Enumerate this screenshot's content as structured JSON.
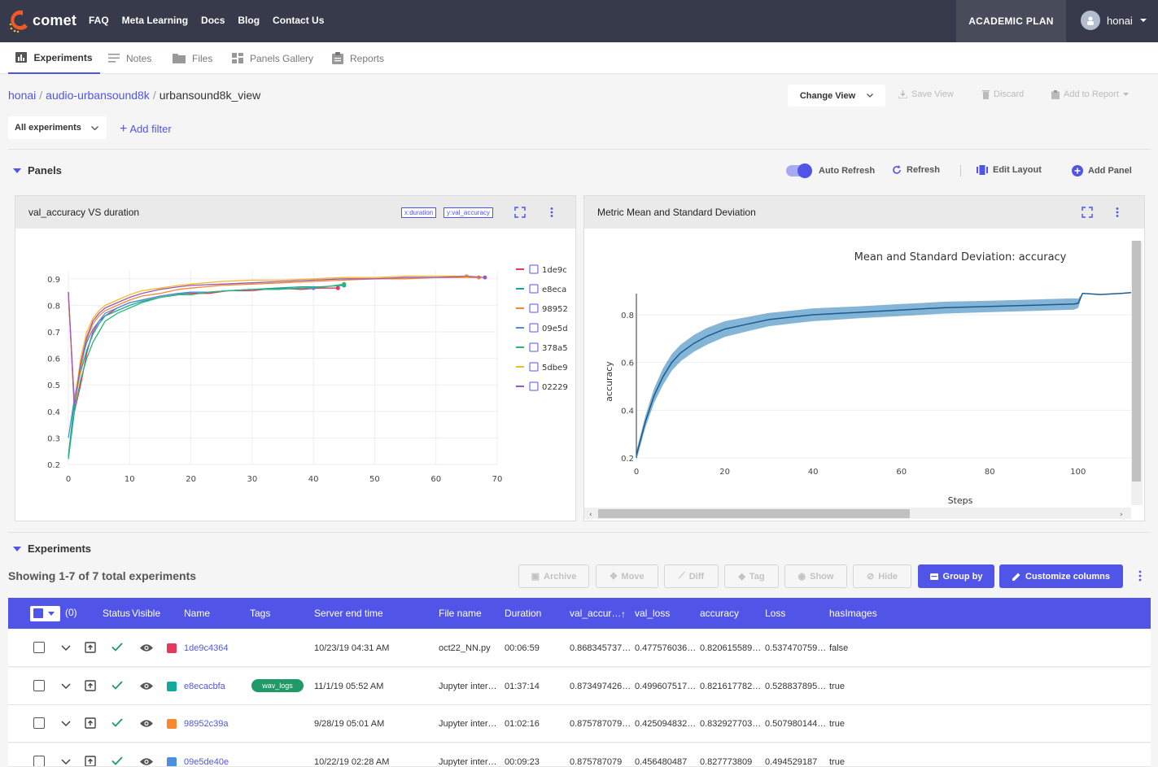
{
  "topbar": {
    "logo": "comet",
    "nav": [
      "FAQ",
      "Meta Learning",
      "Docs",
      "Blog",
      "Contact Us"
    ],
    "plan": "ACADEMIC PLAN",
    "user": "honai"
  },
  "tabs": [
    {
      "label": "Experiments",
      "icon": "bar-chart-icon"
    },
    {
      "label": "Notes",
      "icon": "notes-icon"
    },
    {
      "label": "Files",
      "icon": "folder-icon"
    },
    {
      "label": "Panels Gallery",
      "icon": "gallery-icon"
    },
    {
      "label": "Reports",
      "icon": "clipboard-icon"
    }
  ],
  "breadcrumb": {
    "workspace": "honai",
    "project": "audio-urbansound8k",
    "view": "urbansound8k_view"
  },
  "view_actions": {
    "change_view": "Change View",
    "save_view": "Save View",
    "discard": "Discard",
    "add_to_report": "Add to Report"
  },
  "filters": {
    "selector": "All experiments",
    "add_filter": "Add filter"
  },
  "panels_section": {
    "title": "Panels",
    "auto_refresh": "Auto Refresh",
    "auto_refresh_on": true,
    "refresh": "Refresh",
    "edit_layout": "Edit Layout",
    "add_panel": "Add Panel"
  },
  "panel1": {
    "title": "val_accuracy VS duration",
    "x_tag": "x:duration",
    "y_tag": "y:val_accuracy"
  },
  "panel2": {
    "title": "Metric Mean and Standard Deviation"
  },
  "chart_data": [
    {
      "type": "line",
      "title": "",
      "xlabel": "",
      "ylabel": "",
      "xlim": [
        0,
        70
      ],
      "ylim": [
        0.2,
        0.93
      ],
      "xticks": [
        "0",
        "10",
        "20",
        "30",
        "40",
        "50",
        "60",
        "70"
      ],
      "yticks": [
        "0.2",
        "0.3",
        "0.4",
        "0.5",
        "0.6",
        "0.7",
        "0.8",
        "0.9"
      ],
      "legend": "right",
      "series": [
        {
          "name": "1de9c",
          "color": "#e6375c",
          "x": [
            0,
            1,
            2,
            3,
            4,
            5,
            6,
            8,
            10,
            12,
            15,
            18,
            20,
            23,
            26,
            30,
            34,
            38,
            41,
            44
          ],
          "y": [
            0.85,
            0.4,
            0.5,
            0.62,
            0.7,
            0.74,
            0.76,
            0.79,
            0.81,
            0.82,
            0.835,
            0.845,
            0.845,
            0.845,
            0.855,
            0.855,
            0.865,
            0.86,
            0.865,
            0.865
          ]
        },
        {
          "name": "e8eca",
          "color": "#13a89e",
          "x": [
            0,
            1,
            2,
            3,
            4,
            5,
            6,
            8,
            10,
            12,
            15,
            18,
            20,
            23,
            26,
            30,
            34,
            38,
            41,
            45
          ],
          "y": [
            0.23,
            0.44,
            0.55,
            0.63,
            0.69,
            0.73,
            0.76,
            0.78,
            0.8,
            0.815,
            0.83,
            0.84,
            0.85,
            0.85,
            0.855,
            0.86,
            0.865,
            0.87,
            0.87,
            0.875
          ]
        },
        {
          "name": "98952",
          "color": "#f7882f",
          "x": [
            0,
            1,
            2,
            3,
            4,
            5,
            6,
            8,
            10,
            12,
            15,
            18,
            20,
            25,
            30,
            35,
            40,
            45,
            50,
            55,
            60,
            64,
            67
          ],
          "y": [
            0.84,
            0.42,
            0.56,
            0.67,
            0.73,
            0.76,
            0.78,
            0.8,
            0.82,
            0.835,
            0.845,
            0.86,
            0.865,
            0.875,
            0.88,
            0.885,
            0.89,
            0.895,
            0.9,
            0.9,
            0.905,
            0.905,
            0.905
          ]
        },
        {
          "name": "09e5d",
          "color": "#4a90e2",
          "x": [
            0,
            1,
            2,
            3,
            4,
            5,
            6,
            8,
            10,
            12,
            15,
            18,
            20,
            23,
            26,
            30,
            34,
            38,
            40
          ],
          "y": [
            0.3,
            0.45,
            0.58,
            0.66,
            0.71,
            0.74,
            0.77,
            0.79,
            0.81,
            0.82,
            0.835,
            0.845,
            0.85,
            0.85,
            0.855,
            0.86,
            0.86,
            0.865,
            0.865
          ]
        },
        {
          "name": "378a5",
          "color": "#2bb673",
          "x": [
            0,
            1,
            2,
            3,
            4,
            5,
            6,
            8,
            10,
            12,
            15,
            18,
            20,
            23,
            26,
            30,
            34,
            38,
            42,
            45
          ],
          "y": [
            0.22,
            0.4,
            0.52,
            0.6,
            0.66,
            0.7,
            0.74,
            0.77,
            0.79,
            0.81,
            0.83,
            0.84,
            0.84,
            0.85,
            0.855,
            0.86,
            0.86,
            0.865,
            0.87,
            0.88
          ]
        },
        {
          "name": "5dbe9",
          "color": "#f5b828",
          "x": [
            0,
            1,
            2,
            3,
            4,
            5,
            6,
            8,
            10,
            12,
            15,
            18,
            20,
            25,
            30,
            35,
            40,
            45,
            50,
            55,
            60,
            65
          ],
          "y": [
            0.84,
            0.43,
            0.6,
            0.7,
            0.75,
            0.78,
            0.8,
            0.82,
            0.84,
            0.855,
            0.865,
            0.875,
            0.88,
            0.89,
            0.895,
            0.895,
            0.9,
            0.905,
            0.905,
            0.91,
            0.91,
            0.91
          ]
        },
        {
          "name": "02229",
          "color": "#9b59b6",
          "x": [
            0,
            1,
            2,
            3,
            4,
            5,
            6,
            8,
            10,
            12,
            15,
            18,
            20,
            25,
            30,
            35,
            40,
            45,
            50,
            55,
            60,
            65,
            68
          ],
          "y": [
            0.85,
            0.42,
            0.58,
            0.68,
            0.74,
            0.77,
            0.79,
            0.81,
            0.83,
            0.845,
            0.86,
            0.87,
            0.875,
            0.88,
            0.885,
            0.89,
            0.895,
            0.9,
            0.9,
            0.905,
            0.905,
            0.91,
            0.905
          ]
        }
      ]
    },
    {
      "type": "area",
      "title": "Mean and Standard Deviation: accuracy",
      "xlabel": "Steps",
      "ylabel": "accuracy",
      "xlim": [
        0,
        112
      ],
      "ylim": [
        0.2,
        0.95
      ],
      "xticks": [
        "0",
        "20",
        "40",
        "60",
        "80",
        "100"
      ],
      "yticks": [
        "0.2",
        "0.4",
        "0.6",
        "0.8"
      ],
      "x": [
        0,
        2,
        4,
        6,
        8,
        10,
        13,
        16,
        20,
        25,
        30,
        35,
        40,
        45,
        50,
        60,
        70,
        80,
        90,
        99,
        100,
        101,
        105,
        110,
        112
      ],
      "mean": [
        0.21,
        0.35,
        0.46,
        0.54,
        0.6,
        0.64,
        0.68,
        0.71,
        0.74,
        0.76,
        0.78,
        0.79,
        0.8,
        0.805,
        0.81,
        0.82,
        0.83,
        0.835,
        0.84,
        0.845,
        0.848,
        0.89,
        0.885,
        0.89,
        0.893
      ],
      "band": [
        0.02,
        0.025,
        0.03,
        0.035,
        0.035,
        0.035,
        0.035,
        0.035,
        0.033,
        0.03,
        0.028,
        0.027,
        0.027,
        0.026,
        0.025,
        0.025,
        0.025,
        0.024,
        0.024,
        0.024,
        0.02,
        0.0,
        0.0,
        0.0,
        0.0
      ],
      "color": "#1f77b4"
    }
  ],
  "experiments_section": {
    "title": "Experiments",
    "showing": "Showing 1-7 of 7 total experiments",
    "actions": [
      "Archive",
      "Move",
      "Diff",
      "Tag",
      "Show",
      "Hide"
    ],
    "group_by": "Group by",
    "customize": "Customize columns",
    "selected_count": "(0)"
  },
  "table": {
    "columns": [
      "Status",
      "Visible",
      "Name",
      "Tags",
      "Server end time",
      "File name",
      "Duration",
      "val_accur…",
      "val_loss",
      "accuracy",
      "Loss",
      "hasImages"
    ],
    "rows": [
      {
        "name": "1de9c4364",
        "color": "#e6375c",
        "tag": "",
        "end": "10/23/19 04:31 AM",
        "file": "oct22_NN.py",
        "duration": "00:06:59",
        "val_acc": "0.868345737…",
        "val_loss": "0.477576036…",
        "acc": "0.820615589…",
        "loss": "0.537470759…",
        "images": "false"
      },
      {
        "name": "e8ecacbfa",
        "color": "#13a89e",
        "tag": "wav_logs",
        "end": "11/1/19 05:52 AM",
        "file": "Jupyter inter…",
        "duration": "01:37:14",
        "val_acc": "0.873497426…",
        "val_loss": "0.499607517…",
        "acc": "0.821617782…",
        "loss": "0.528837895…",
        "images": "true"
      },
      {
        "name": "98952c39a",
        "color": "#f7882f",
        "tag": "",
        "end": "9/28/19 05:01 AM",
        "file": "Jupyter inter…",
        "duration": "01:02:16",
        "val_acc": "0.875787079…",
        "val_loss": "0.425094832…",
        "acc": "0.832927703…",
        "loss": "0.507980144…",
        "images": "true"
      },
      {
        "name": "09e5de40e",
        "color": "#4a90e2",
        "tag": "",
        "end": "10/22/19 02:28 AM",
        "file": "Jupyter inter…",
        "duration": "00:09:23",
        "val_acc": "0.875787079",
        "val_loss": "0.456480487",
        "acc": "0.827773809",
        "loss": "0.494529187",
        "images": "true"
      }
    ]
  }
}
